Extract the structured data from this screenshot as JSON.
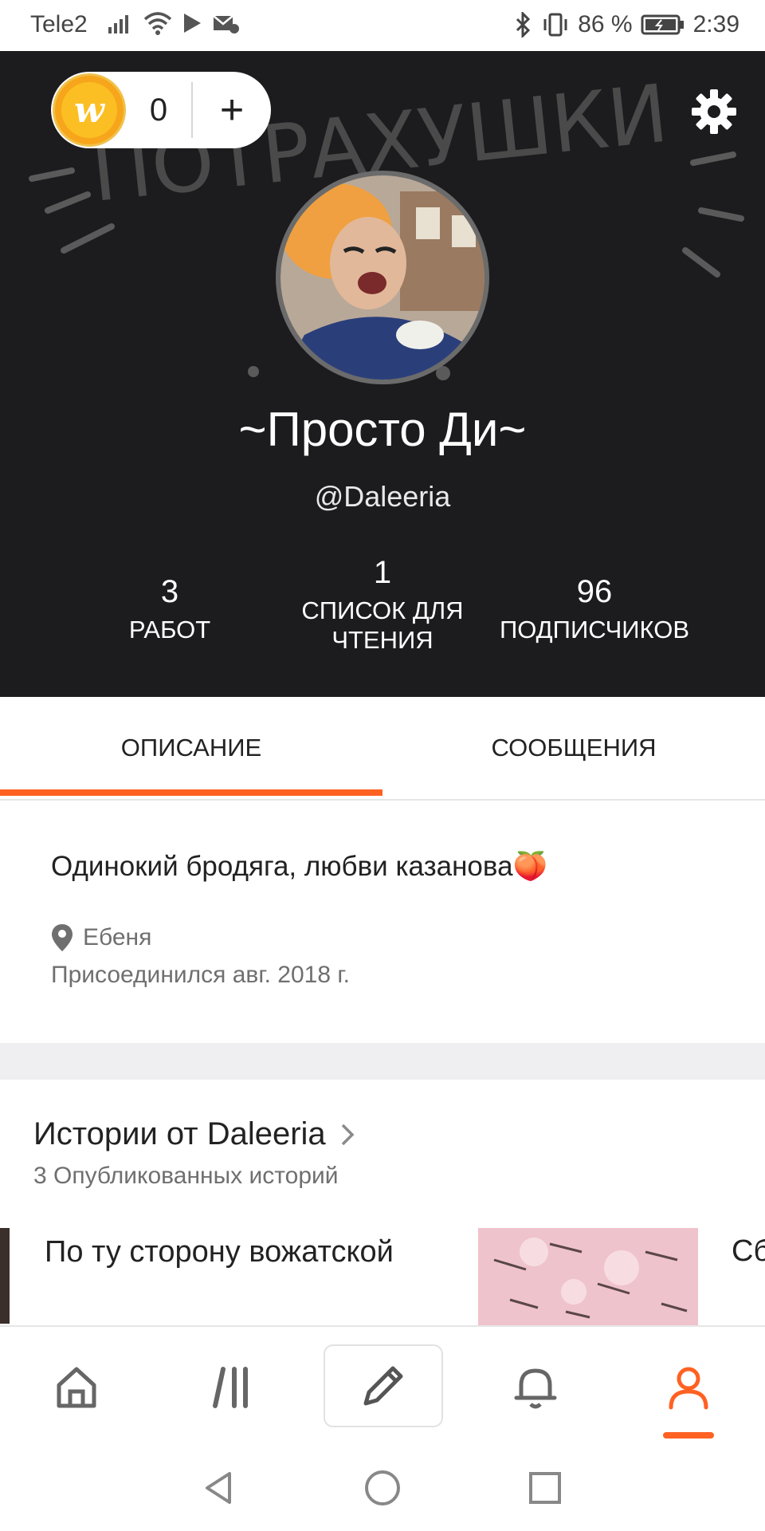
{
  "status_bar": {
    "carrier": "Tele2",
    "battery": "86 %",
    "time": "2:39"
  },
  "header": {
    "coins": {
      "count": "0",
      "plus": "+"
    },
    "banner_text": "ПОТРАХУШКИ",
    "display_name": "~Просто Ди~",
    "username": "@Daleeria",
    "stats": [
      {
        "value": "3",
        "label": "РАБОТ"
      },
      {
        "value": "1",
        "label": "СПИСОК ДЛЯ ЧТЕНИЯ"
      },
      {
        "value": "96",
        "label": "ПОДПИСЧИКОВ"
      }
    ]
  },
  "tabs": [
    {
      "label": "ОПИСАНИЕ",
      "active": true
    },
    {
      "label": "СООБЩЕНИЯ",
      "active": false
    }
  ],
  "about": {
    "bio": "Одинокий бродяга, любви казанова🍑",
    "location": "Ебеня",
    "joined": "Присоединился авг. 2018 г."
  },
  "stories": {
    "title": "Истории от Daleeria",
    "subtitle": "3 Опубликованных историй",
    "items": [
      {
        "title": "По ту сторону вожатской"
      },
      {
        "title": "Сб"
      }
    ]
  },
  "bottom_nav": {
    "items": [
      "home-icon",
      "library-icon",
      "pencil-icon",
      "bell-icon",
      "profile-icon"
    ],
    "active": "profile-icon"
  },
  "colors": {
    "accent": "#ff6122",
    "header_bg": "#1c1b1e",
    "coin": "#f7a51a"
  }
}
